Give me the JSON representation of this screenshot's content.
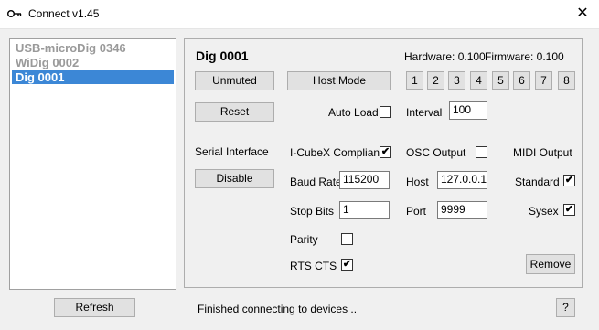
{
  "window": {
    "title": "Connect v1.45",
    "close_glyph": "✕"
  },
  "device_list": {
    "items": [
      {
        "label": "USB-microDig 0346",
        "state": "inactive"
      },
      {
        "label": "WiDig 0002",
        "state": "inactive"
      },
      {
        "label": "Dig 0001",
        "state": "selected"
      }
    ]
  },
  "device": {
    "name": "Dig 0001",
    "hardware": "Hardware: 0.100",
    "firmware": "Firmware: 0.100",
    "unmuted_label": "Unmuted",
    "host_mode_label": "Host Mode",
    "channels": [
      "1",
      "2",
      "3",
      "4",
      "5",
      "6",
      "7",
      "8"
    ],
    "reset_label": "Reset",
    "auto_load_label": "Auto Load",
    "auto_load_checked": false,
    "interval_label": "Interval",
    "interval_value": "100",
    "serial_label": "Serial Interface",
    "disable_label": "Disable",
    "icubex_label": "I-CubeX Compliant",
    "icubex_checked": true,
    "osc_label": "OSC Output",
    "osc_checked": false,
    "midi_label": "MIDI Output",
    "baud_label": "Baud Rate",
    "baud_value": "115200",
    "host_label": "Host",
    "host_value": "127.0.0.1",
    "standard_label": "Standard",
    "standard_checked": true,
    "stop_bits_label": "Stop Bits",
    "stop_bits_value": "1",
    "port_label": "Port",
    "port_value": "9999",
    "sysex_label": "Sysex",
    "sysex_checked": true,
    "parity_label": "Parity",
    "parity_checked": false,
    "rts_label": "RTS CTS",
    "rts_checked": true,
    "remove_label": "Remove"
  },
  "footer": {
    "refresh_label": "Refresh",
    "status": "Finished connecting to devices ..",
    "help_label": "?"
  },
  "colors": {
    "selected_bg": "#3c87d6",
    "inactive_text": "#9a9a9a",
    "accent": "#0078d7"
  },
  "check_glyph": "✔"
}
